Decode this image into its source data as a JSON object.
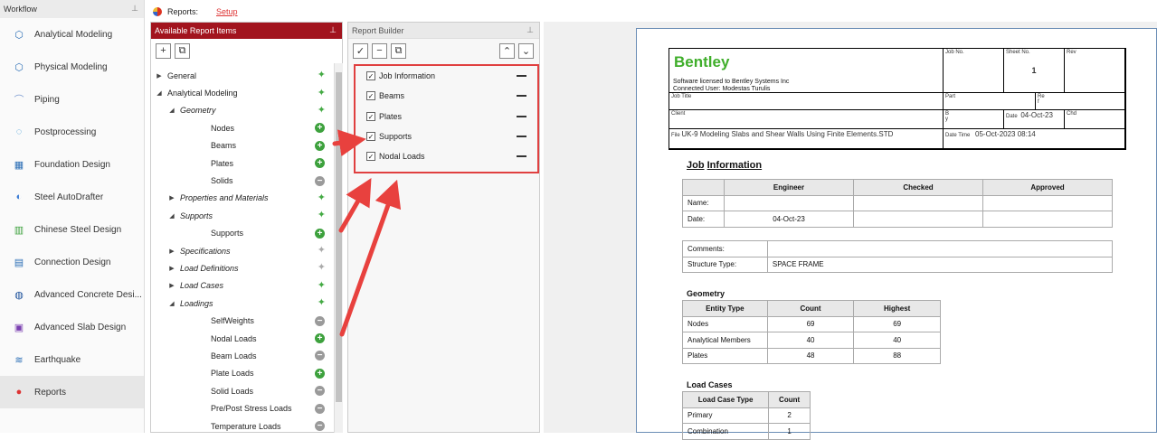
{
  "workflow": {
    "title": "Workflow",
    "pin": "⊥",
    "items": [
      {
        "label": "Analytical Modeling",
        "icon": "analytical-modeling-icon",
        "glyph": "⬡"
      },
      {
        "label": "Physical Modeling",
        "icon": "physical-modeling-icon",
        "glyph": "⬡"
      },
      {
        "label": "Piping",
        "icon": "piping-icon",
        "glyph": "⌒"
      },
      {
        "label": "Postprocessing",
        "icon": "postprocessing-icon",
        "glyph": "◌"
      },
      {
        "label": "Foundation Design",
        "icon": "foundation-design-icon",
        "glyph": "▦"
      },
      {
        "label": "Steel AutoDrafter",
        "icon": "steel-autodrafter-icon",
        "glyph": "◐"
      },
      {
        "label": "Chinese Steel Design",
        "icon": "chinese-steel-design-icon",
        "glyph": "▥"
      },
      {
        "label": "Connection Design",
        "icon": "connection-design-icon",
        "glyph": "▤"
      },
      {
        "label": "Advanced Concrete Desi...",
        "icon": "advanced-concrete-design-icon",
        "glyph": "◍"
      },
      {
        "label": "Advanced Slab Design",
        "icon": "advanced-slab-design-icon",
        "glyph": "▣"
      },
      {
        "label": "Earthquake",
        "icon": "earthquake-icon",
        "glyph": "≋"
      },
      {
        "label": "Reports",
        "icon": "reports-icon",
        "glyph": "●"
      }
    ]
  },
  "topbar": {
    "reports": "Reports:",
    "setup": "Setup"
  },
  "available": {
    "title": "Available Report Items",
    "pin": "⊥",
    "add": "+",
    "copy": "⧉",
    "tree": [
      {
        "label": "General",
        "arrow": "▶",
        "indent": 0,
        "italic": false,
        "icon": "spark-green"
      },
      {
        "label": "Analytical Modeling",
        "arrow": "◢",
        "indent": 0,
        "italic": false,
        "icon": "spark-green"
      },
      {
        "label": "Geometry",
        "arrow": "◢",
        "indent": 1,
        "italic": true,
        "icon": "spark-green"
      },
      {
        "label": "Nodes",
        "arrow": "",
        "indent": 2,
        "italic": false,
        "icon": "plus"
      },
      {
        "label": "Beams",
        "arrow": "",
        "indent": 2,
        "italic": false,
        "icon": "plus"
      },
      {
        "label": "Plates",
        "arrow": "",
        "indent": 2,
        "italic": false,
        "icon": "plus"
      },
      {
        "label": "Solids",
        "arrow": "",
        "indent": 2,
        "italic": false,
        "icon": "minus"
      },
      {
        "label": "Properties and Materials",
        "arrow": "▶",
        "indent": 1,
        "italic": true,
        "icon": "spark-green"
      },
      {
        "label": "Supports",
        "arrow": "◢",
        "indent": 1,
        "italic": true,
        "icon": "spark-green"
      },
      {
        "label": "Supports",
        "arrow": "",
        "indent": 2,
        "italic": false,
        "icon": "plus"
      },
      {
        "label": "Specifications",
        "arrow": "▶",
        "indent": 1,
        "italic": true,
        "icon": "spark-gray"
      },
      {
        "label": "Load Definitions",
        "arrow": "▶",
        "indent": 1,
        "italic": true,
        "icon": "spark-gray"
      },
      {
        "label": "Load Cases",
        "arrow": "▶",
        "indent": 1,
        "italic": true,
        "icon": "spark-green"
      },
      {
        "label": "Loadings",
        "arrow": "◢",
        "indent": 1,
        "italic": true,
        "icon": "spark-green"
      },
      {
        "label": "SelfWeights",
        "arrow": "",
        "indent": 2,
        "italic": false,
        "icon": "minus"
      },
      {
        "label": "Nodal Loads",
        "arrow": "",
        "indent": 2,
        "italic": false,
        "icon": "plus"
      },
      {
        "label": "Beam Loads",
        "arrow": "",
        "indent": 2,
        "italic": false,
        "icon": "minus"
      },
      {
        "label": "Plate Loads",
        "arrow": "",
        "indent": 2,
        "italic": false,
        "icon": "plus"
      },
      {
        "label": "Solid Loads",
        "arrow": "",
        "indent": 2,
        "italic": false,
        "icon": "minus"
      },
      {
        "label": "Pre/Post Stress Loads",
        "arrow": "",
        "indent": 2,
        "italic": false,
        "icon": "minus"
      },
      {
        "label": "Temperature Loads",
        "arrow": "",
        "indent": 2,
        "italic": false,
        "icon": "minus"
      }
    ]
  },
  "builder": {
    "title": "Report Builder",
    "pin": "⊥",
    "check": "✓",
    "minus": "−",
    "copy": "⧉",
    "up": "⌃",
    "down": "⌄",
    "items": [
      {
        "label": "Job Information",
        "checked": "✓"
      },
      {
        "label": "Beams",
        "checked": "✓"
      },
      {
        "label": "Plates",
        "checked": "✓"
      },
      {
        "label": "Supports",
        "checked": "✓"
      },
      {
        "label": "Nodal Loads",
        "checked": "✓"
      }
    ]
  },
  "preview": {
    "logo": "Bentley",
    "license": "Software licensed to Bentley Systems Inc",
    "user": "Connected User: Modestas Turulis",
    "job_no": "Job No.",
    "sheet_no": "Sheet No.",
    "sheet_val": "1",
    "rev": "Rev",
    "job_title": "Job Title",
    "part": "Part",
    "ref": "Re\nf",
    "client": "Client",
    "by": "B\ny",
    "date_lbl": "Date",
    "date_val": "04-Oct-23",
    "chd": "Chd",
    "file_lbl": "File",
    "file_val": "UK-9 Modeling Slabs and Shear Walls Using Finite Elements.STD",
    "dt_lbl": "Date Time",
    "dt_val": "05-Oct-2023 08:14",
    "jobinfo": {
      "title1": "Job",
      "title2": "Information",
      "h": [
        "",
        "Engineer",
        "Checked",
        "Approved"
      ],
      "rows": [
        [
          "Name:",
          "",
          "",
          ""
        ],
        [
          "Date:",
          "04-Oct-23",
          "",
          ""
        ]
      ]
    },
    "comments": {
      "rows": [
        [
          "Comments:",
          ""
        ],
        [
          "Structure Type:",
          "SPACE FRAME"
        ]
      ]
    },
    "geometry": {
      "title": "Geometry",
      "h": [
        "Entity Type",
        "Count",
        "Highest"
      ],
      "rows": [
        [
          "Nodes",
          "69",
          "69"
        ],
        [
          "Analytical Members",
          "40",
          "40"
        ],
        [
          "Plates",
          "48",
          "88"
        ]
      ]
    },
    "loadcases": {
      "title": "Load Cases",
      "h": [
        "Load Case Type",
        "Count"
      ],
      "rows": [
        [
          "Primary",
          "2"
        ],
        [
          "Combination",
          "1"
        ]
      ]
    }
  },
  "colors": {
    "accent": "#a2141e",
    "highlight": "#e04040",
    "bentley": "#3fae2a"
  }
}
